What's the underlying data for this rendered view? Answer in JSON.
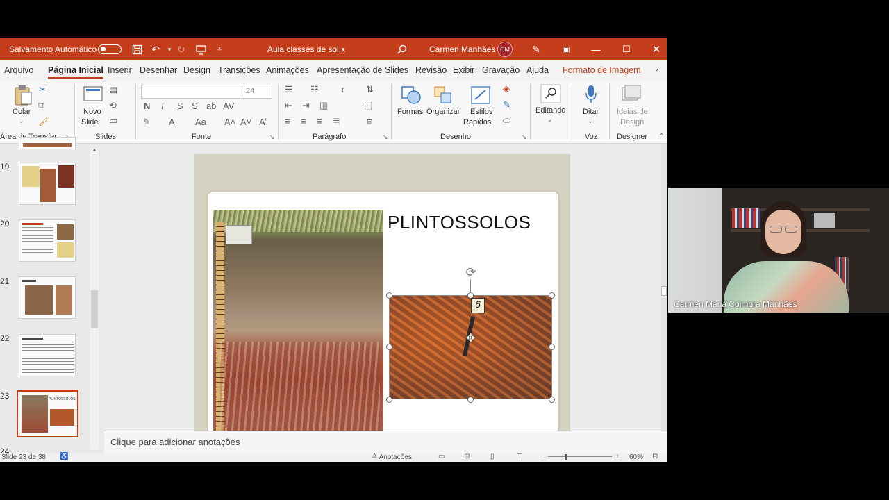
{
  "titlebar": {
    "autosave_label": "Salvamento Automático",
    "doc_title": "Aula classes de sol...",
    "user_name": "Carmen Manhães",
    "user_initials": "CM"
  },
  "tabs": [
    {
      "label": "Arquivo"
    },
    {
      "label": "Página Inicial"
    },
    {
      "label": "Inserir"
    },
    {
      "label": "Desenhar"
    },
    {
      "label": "Design"
    },
    {
      "label": "Transições"
    },
    {
      "label": "Animações"
    },
    {
      "label": "Apresentação de Slides"
    },
    {
      "label": "Revisão"
    },
    {
      "label": "Exibir"
    },
    {
      "label": "Gravação"
    },
    {
      "label": "Ajuda"
    },
    {
      "label": "Formato de Imagem"
    }
  ],
  "ribbon": {
    "clipboard": {
      "paste_label": "Colar",
      "group_label": "Área de Transfer..."
    },
    "slides": {
      "new_slide_label_1": "Novo",
      "new_slide_label_2": "Slide",
      "group_label": "Slides"
    },
    "font": {
      "font_size": "24",
      "bold": "N",
      "italic": "I",
      "underline": "S",
      "strike": "S",
      "group_label": "Fonte"
    },
    "paragraph": {
      "group_label": "Parágrafo"
    },
    "drawing": {
      "shapes_label": "Formas",
      "arrange_label": "Organizar",
      "styles_label_1": "Estilos",
      "styles_label_2": "Rápidos",
      "group_label": "Desenho"
    },
    "editing": {
      "label": "Editando"
    },
    "voice": {
      "dictate_label": "Ditar",
      "group_label": "Voz"
    },
    "designer": {
      "ideas_label_1": "Ideias de",
      "ideas_label_2": "Design",
      "group_label": "Designer"
    }
  },
  "thumbnails": [
    {
      "number": "19"
    },
    {
      "number": "20"
    },
    {
      "number": "21"
    },
    {
      "number": "22"
    },
    {
      "number": "23",
      "selected": true
    },
    {
      "number": "24"
    }
  ],
  "slide": {
    "title": "PLINTOSSOLOS",
    "photo_tag": "6",
    "thumb_title": "PLINTOSSOLOS"
  },
  "notes": {
    "placeholder": "Clique para adicionar anotações"
  },
  "status": {
    "slide_counter": "Slide 23 de 38",
    "notes_label": "Anotações",
    "zoom": "60%"
  },
  "video": {
    "participant_name": "Carmen Maria Coimbra Manhães"
  }
}
